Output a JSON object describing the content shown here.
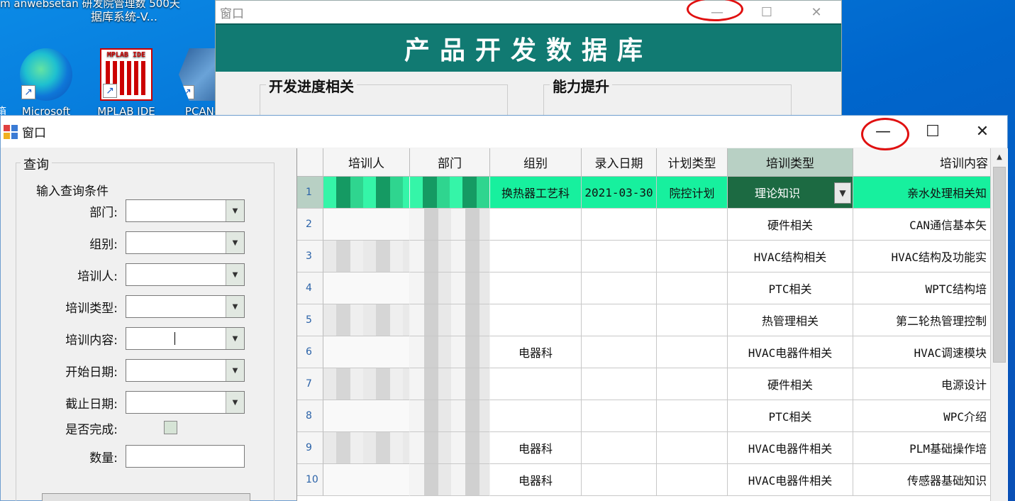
{
  "desktop": {
    "topline": "m anwebsetan 研发院管理数      500天",
    "topline2": "据库系统-V...",
    "icons": [
      {
        "label": "Microsoft",
        "icon": "edge-icon"
      },
      {
        "label": "MPLAB IDE",
        "icon": "mplab-icon",
        "text": "MPLAB IDE"
      },
      {
        "label": "PCAN-B",
        "icon": "pcan-icon"
      }
    ],
    "left_fragment": "箱"
  },
  "back_window": {
    "title": "窗口",
    "banner": "产品开发数据库",
    "groups": [
      "开发进度相关",
      "能力提升"
    ],
    "controls": {
      "minimize": "—",
      "maximize": "☐",
      "close": "✕"
    }
  },
  "front_window": {
    "title": "窗口",
    "controls": {
      "minimize": "—",
      "maximize": "☐",
      "close": "✕"
    },
    "query": {
      "group_label": "查询",
      "subheading": "输入查询条件",
      "fields": [
        {
          "label": "部门:",
          "type": "combo",
          "value": ""
        },
        {
          "label": "组别:",
          "type": "combo",
          "value": ""
        },
        {
          "label": "培训人:",
          "type": "combo",
          "value": ""
        },
        {
          "label": "培训类型:",
          "type": "combo",
          "value": ""
        },
        {
          "label": "培训内容:",
          "type": "combo",
          "value": ""
        },
        {
          "label": "开始日期:",
          "type": "combo",
          "value": ""
        },
        {
          "label": "截止日期:",
          "type": "combo",
          "value": ""
        },
        {
          "label": "是否完成:",
          "type": "checkbox",
          "value": ""
        },
        {
          "label": "数量:",
          "type": "text",
          "value": ""
        }
      ]
    },
    "grid": {
      "columns": [
        "",
        "培训人",
        "部门",
        "组别",
        "录入日期",
        "计划类型",
        "培训类型",
        "培训内容"
      ],
      "rows": [
        {
          "no": "1",
          "group": "换热器工艺科",
          "date": "2021-03-30",
          "plan": "院控计划",
          "ttype": "理论知识",
          "content": "亲水处理相关知"
        },
        {
          "no": "2",
          "group": "",
          "date": "",
          "plan": "",
          "ttype": "硬件相关",
          "content": "CAN通信基本矢"
        },
        {
          "no": "3",
          "group": "",
          "date": "",
          "plan": "",
          "ttype": "HVAC结构相关",
          "content": "HVAC结构及功能实"
        },
        {
          "no": "4",
          "group": "",
          "date": "",
          "plan": "",
          "ttype": "PTC相关",
          "content": "WPTC结构培"
        },
        {
          "no": "5",
          "group": "",
          "date": "",
          "plan": "",
          "ttype": "热管理相关",
          "content": "第二轮热管理控制"
        },
        {
          "no": "6",
          "group": "电器科",
          "date": "",
          "plan": "",
          "ttype": "HVAC电器件相关",
          "content": "HVAC调速模块"
        },
        {
          "no": "7",
          "group": "",
          "date": "",
          "plan": "",
          "ttype": "硬件相关",
          "content": "电源设计"
        },
        {
          "no": "8",
          "group": "",
          "date": "",
          "plan": "",
          "ttype": "PTC相关",
          "content": "WPC介绍"
        },
        {
          "no": "9",
          "group": "电器科",
          "date": "",
          "plan": "",
          "ttype": "HVAC电器件相关",
          "content": "PLM基础操作培"
        },
        {
          "no": "10",
          "group": "电器科",
          "date": "",
          "plan": "",
          "ttype": "HVAC电器件相关",
          "content": "传感器基础知识"
        }
      ]
    }
  },
  "colors": {
    "banner": "#117a72",
    "selected_row": "#17f09e",
    "combo_cell": "#1c6a42",
    "highlight_circle": "#e01010"
  }
}
